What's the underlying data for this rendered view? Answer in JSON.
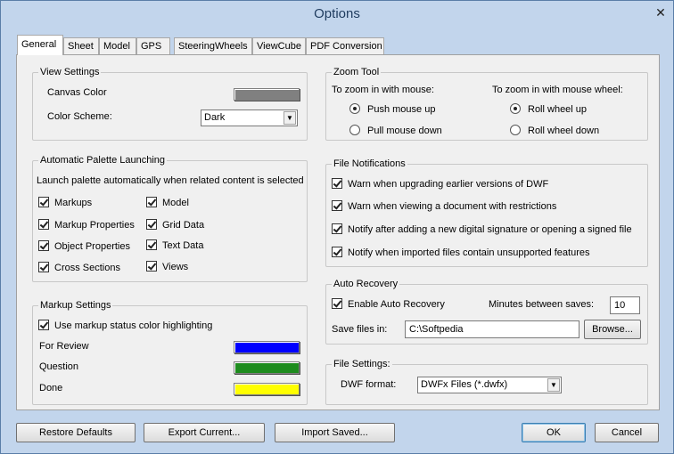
{
  "window": {
    "title": "Options",
    "close": "✕"
  },
  "tabs": [
    "General",
    "Sheet",
    "Model",
    "GPS",
    "SteeringWheels",
    "ViewCube",
    "PDF Conversion"
  ],
  "view_settings": {
    "legend": "View Settings",
    "canvas_color_label": "Canvas Color",
    "canvas_color": "#808080",
    "color_scheme_label": "Color Scheme:",
    "color_scheme_value": "Dark"
  },
  "palette": {
    "legend": "Automatic Palette Launching",
    "description": "Launch palette automatically when related content is selected",
    "items": [
      "Markups",
      "Markup Properties",
      "Object Properties",
      "Cross Sections",
      "Model",
      "Grid Data",
      "Text Data",
      "Views"
    ]
  },
  "markup": {
    "legend": "Markup Settings",
    "highlight_label": "Use markup status color highlighting",
    "statuses": [
      {
        "label": "For Review",
        "color": "#0000ff"
      },
      {
        "label": "Question",
        "color": "#1e8c1e"
      },
      {
        "label": "Done",
        "color": "#ffff00"
      }
    ]
  },
  "zoom": {
    "legend": "Zoom Tool",
    "mouse_label": "To zoom in with mouse:",
    "wheel_label": "To zoom in with mouse wheel:",
    "push_up": "Push mouse up",
    "pull_down": "Pull mouse down",
    "roll_up": "Roll wheel up",
    "roll_down": "Roll wheel down"
  },
  "notifications": {
    "legend": "File Notifications",
    "items": [
      "Warn when upgrading earlier versions of DWF",
      "Warn when viewing a document with restrictions",
      "Notify after adding a new digital signature or opening a signed file",
      "Notify when imported files contain unsupported features"
    ]
  },
  "recovery": {
    "legend": "Auto Recovery",
    "enable_label": "Enable Auto Recovery",
    "minutes_label": "Minutes between saves:",
    "minutes_value": "10",
    "save_in_label": "Save files in:",
    "save_in_value": "C:\\Softpedia",
    "browse_label": "Browse..."
  },
  "file_settings": {
    "legend": "File Settings:",
    "format_label": "DWF format:",
    "format_value": "DWFx Files (*.dwfx)"
  },
  "buttons": {
    "restore": "Restore Defaults",
    "export": "Export Current...",
    "import": "Import Saved...",
    "ok": "OK",
    "cancel": "Cancel"
  }
}
